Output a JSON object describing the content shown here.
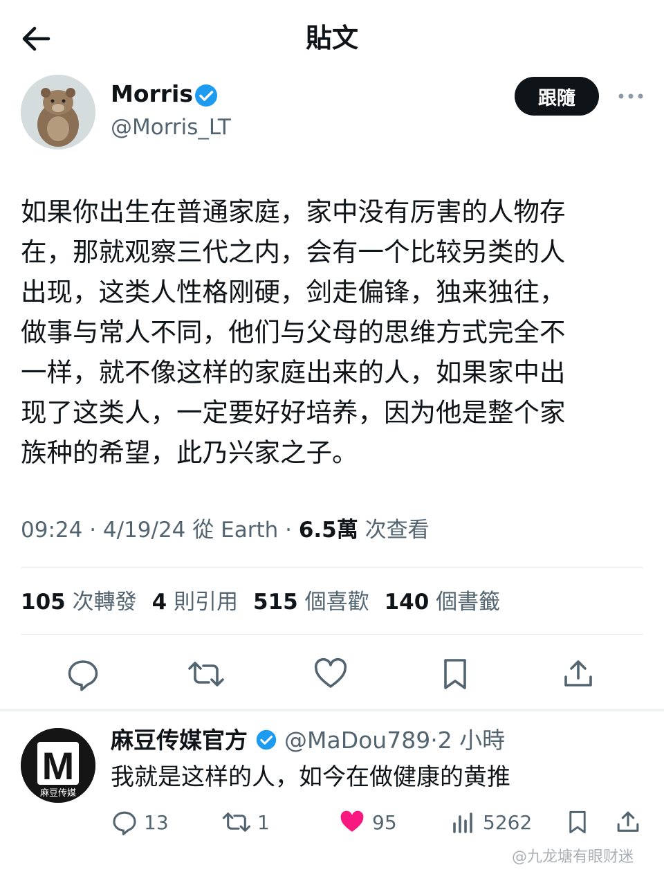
{
  "header": {
    "title": "貼文"
  },
  "author": {
    "name": "Morris",
    "handle": "@Morris_LT",
    "follow_label": "跟隨"
  },
  "post": {
    "text": "如果你出生在普通家庭，家中没有厉害的人物存\n在，那就观察三代之内，会有一个比较另类的人\n出现，这类人性格刚硬，剑走偏锋，独来独往，\n做事与常人不同，他们与父母的思维方式完全不\n一样，就不像这样的家庭出来的人，如果家中出\n现了这类人，一定要好好培养，因为他是整个家\n族种的希望，此乃兴家之子。",
    "time": "09:24 · 4/19/24 從 Earth · ",
    "views": "6.5萬",
    "views_label": " 次查看"
  },
  "stats": {
    "retweets": "105",
    "retweets_label": "次轉發",
    "quotes": "4",
    "quotes_label": "則引用",
    "likes": "515",
    "likes_label": "個喜歡",
    "bookmarks": "140",
    "bookmarks_label": "個書籤"
  },
  "reply": {
    "name": "麻豆传媒官方",
    "handle": "@MaDou789",
    "time": "·2 小時",
    "avatar_text": "麻豆传媒",
    "avatar_letter": "M",
    "text": "我就是这样的人，如今在做健康的黄推",
    "replies": "13",
    "retweets": "1",
    "likes": "95",
    "views": "5262"
  },
  "watermark": "@九龙塘有眼财迷",
  "colors": {
    "verified": "#1d9bf0",
    "like": "#f91880",
    "muted": "#536471"
  }
}
